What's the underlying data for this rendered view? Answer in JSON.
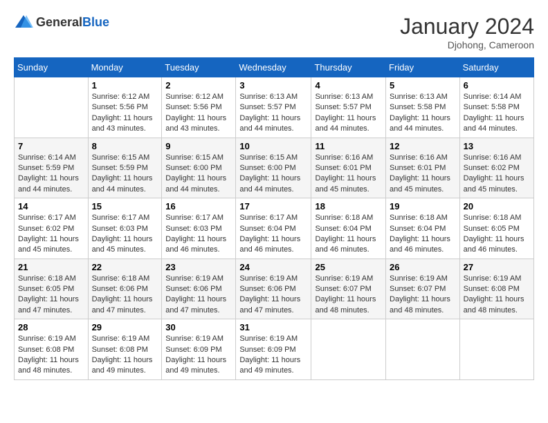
{
  "header": {
    "logo_general": "General",
    "logo_blue": "Blue",
    "month_title": "January 2024",
    "location": "Djohong, Cameroon"
  },
  "days_of_week": [
    "Sunday",
    "Monday",
    "Tuesday",
    "Wednesday",
    "Thursday",
    "Friday",
    "Saturday"
  ],
  "weeks": [
    [
      {
        "day": "",
        "sunrise": "",
        "sunset": "",
        "daylight": ""
      },
      {
        "day": "1",
        "sunrise": "Sunrise: 6:12 AM",
        "sunset": "Sunset: 5:56 PM",
        "daylight": "Daylight: 11 hours and 43 minutes."
      },
      {
        "day": "2",
        "sunrise": "Sunrise: 6:12 AM",
        "sunset": "Sunset: 5:56 PM",
        "daylight": "Daylight: 11 hours and 43 minutes."
      },
      {
        "day": "3",
        "sunrise": "Sunrise: 6:13 AM",
        "sunset": "Sunset: 5:57 PM",
        "daylight": "Daylight: 11 hours and 44 minutes."
      },
      {
        "day": "4",
        "sunrise": "Sunrise: 6:13 AM",
        "sunset": "Sunset: 5:57 PM",
        "daylight": "Daylight: 11 hours and 44 minutes."
      },
      {
        "day": "5",
        "sunrise": "Sunrise: 6:13 AM",
        "sunset": "Sunset: 5:58 PM",
        "daylight": "Daylight: 11 hours and 44 minutes."
      },
      {
        "day": "6",
        "sunrise": "Sunrise: 6:14 AM",
        "sunset": "Sunset: 5:58 PM",
        "daylight": "Daylight: 11 hours and 44 minutes."
      }
    ],
    [
      {
        "day": "7",
        "sunrise": "Sunrise: 6:14 AM",
        "sunset": "Sunset: 5:59 PM",
        "daylight": "Daylight: 11 hours and 44 minutes."
      },
      {
        "day": "8",
        "sunrise": "Sunrise: 6:15 AM",
        "sunset": "Sunset: 5:59 PM",
        "daylight": "Daylight: 11 hours and 44 minutes."
      },
      {
        "day": "9",
        "sunrise": "Sunrise: 6:15 AM",
        "sunset": "Sunset: 6:00 PM",
        "daylight": "Daylight: 11 hours and 44 minutes."
      },
      {
        "day": "10",
        "sunrise": "Sunrise: 6:15 AM",
        "sunset": "Sunset: 6:00 PM",
        "daylight": "Daylight: 11 hours and 44 minutes."
      },
      {
        "day": "11",
        "sunrise": "Sunrise: 6:16 AM",
        "sunset": "Sunset: 6:01 PM",
        "daylight": "Daylight: 11 hours and 45 minutes."
      },
      {
        "day": "12",
        "sunrise": "Sunrise: 6:16 AM",
        "sunset": "Sunset: 6:01 PM",
        "daylight": "Daylight: 11 hours and 45 minutes."
      },
      {
        "day": "13",
        "sunrise": "Sunrise: 6:16 AM",
        "sunset": "Sunset: 6:02 PM",
        "daylight": "Daylight: 11 hours and 45 minutes."
      }
    ],
    [
      {
        "day": "14",
        "sunrise": "Sunrise: 6:17 AM",
        "sunset": "Sunset: 6:02 PM",
        "daylight": "Daylight: 11 hours and 45 minutes."
      },
      {
        "day": "15",
        "sunrise": "Sunrise: 6:17 AM",
        "sunset": "Sunset: 6:03 PM",
        "daylight": "Daylight: 11 hours and 45 minutes."
      },
      {
        "day": "16",
        "sunrise": "Sunrise: 6:17 AM",
        "sunset": "Sunset: 6:03 PM",
        "daylight": "Daylight: 11 hours and 46 minutes."
      },
      {
        "day": "17",
        "sunrise": "Sunrise: 6:17 AM",
        "sunset": "Sunset: 6:04 PM",
        "daylight": "Daylight: 11 hours and 46 minutes."
      },
      {
        "day": "18",
        "sunrise": "Sunrise: 6:18 AM",
        "sunset": "Sunset: 6:04 PM",
        "daylight": "Daylight: 11 hours and 46 minutes."
      },
      {
        "day": "19",
        "sunrise": "Sunrise: 6:18 AM",
        "sunset": "Sunset: 6:04 PM",
        "daylight": "Daylight: 11 hours and 46 minutes."
      },
      {
        "day": "20",
        "sunrise": "Sunrise: 6:18 AM",
        "sunset": "Sunset: 6:05 PM",
        "daylight": "Daylight: 11 hours and 46 minutes."
      }
    ],
    [
      {
        "day": "21",
        "sunrise": "Sunrise: 6:18 AM",
        "sunset": "Sunset: 6:05 PM",
        "daylight": "Daylight: 11 hours and 47 minutes."
      },
      {
        "day": "22",
        "sunrise": "Sunrise: 6:18 AM",
        "sunset": "Sunset: 6:06 PM",
        "daylight": "Daylight: 11 hours and 47 minutes."
      },
      {
        "day": "23",
        "sunrise": "Sunrise: 6:19 AM",
        "sunset": "Sunset: 6:06 PM",
        "daylight": "Daylight: 11 hours and 47 minutes."
      },
      {
        "day": "24",
        "sunrise": "Sunrise: 6:19 AM",
        "sunset": "Sunset: 6:06 PM",
        "daylight": "Daylight: 11 hours and 47 minutes."
      },
      {
        "day": "25",
        "sunrise": "Sunrise: 6:19 AM",
        "sunset": "Sunset: 6:07 PM",
        "daylight": "Daylight: 11 hours and 48 minutes."
      },
      {
        "day": "26",
        "sunrise": "Sunrise: 6:19 AM",
        "sunset": "Sunset: 6:07 PM",
        "daylight": "Daylight: 11 hours and 48 minutes."
      },
      {
        "day": "27",
        "sunrise": "Sunrise: 6:19 AM",
        "sunset": "Sunset: 6:08 PM",
        "daylight": "Daylight: 11 hours and 48 minutes."
      }
    ],
    [
      {
        "day": "28",
        "sunrise": "Sunrise: 6:19 AM",
        "sunset": "Sunset: 6:08 PM",
        "daylight": "Daylight: 11 hours and 48 minutes."
      },
      {
        "day": "29",
        "sunrise": "Sunrise: 6:19 AM",
        "sunset": "Sunset: 6:08 PM",
        "daylight": "Daylight: 11 hours and 49 minutes."
      },
      {
        "day": "30",
        "sunrise": "Sunrise: 6:19 AM",
        "sunset": "Sunset: 6:09 PM",
        "daylight": "Daylight: 11 hours and 49 minutes."
      },
      {
        "day": "31",
        "sunrise": "Sunrise: 6:19 AM",
        "sunset": "Sunset: 6:09 PM",
        "daylight": "Daylight: 11 hours and 49 minutes."
      },
      {
        "day": "",
        "sunrise": "",
        "sunset": "",
        "daylight": ""
      },
      {
        "day": "",
        "sunrise": "",
        "sunset": "",
        "daylight": ""
      },
      {
        "day": "",
        "sunrise": "",
        "sunset": "",
        "daylight": ""
      }
    ]
  ]
}
